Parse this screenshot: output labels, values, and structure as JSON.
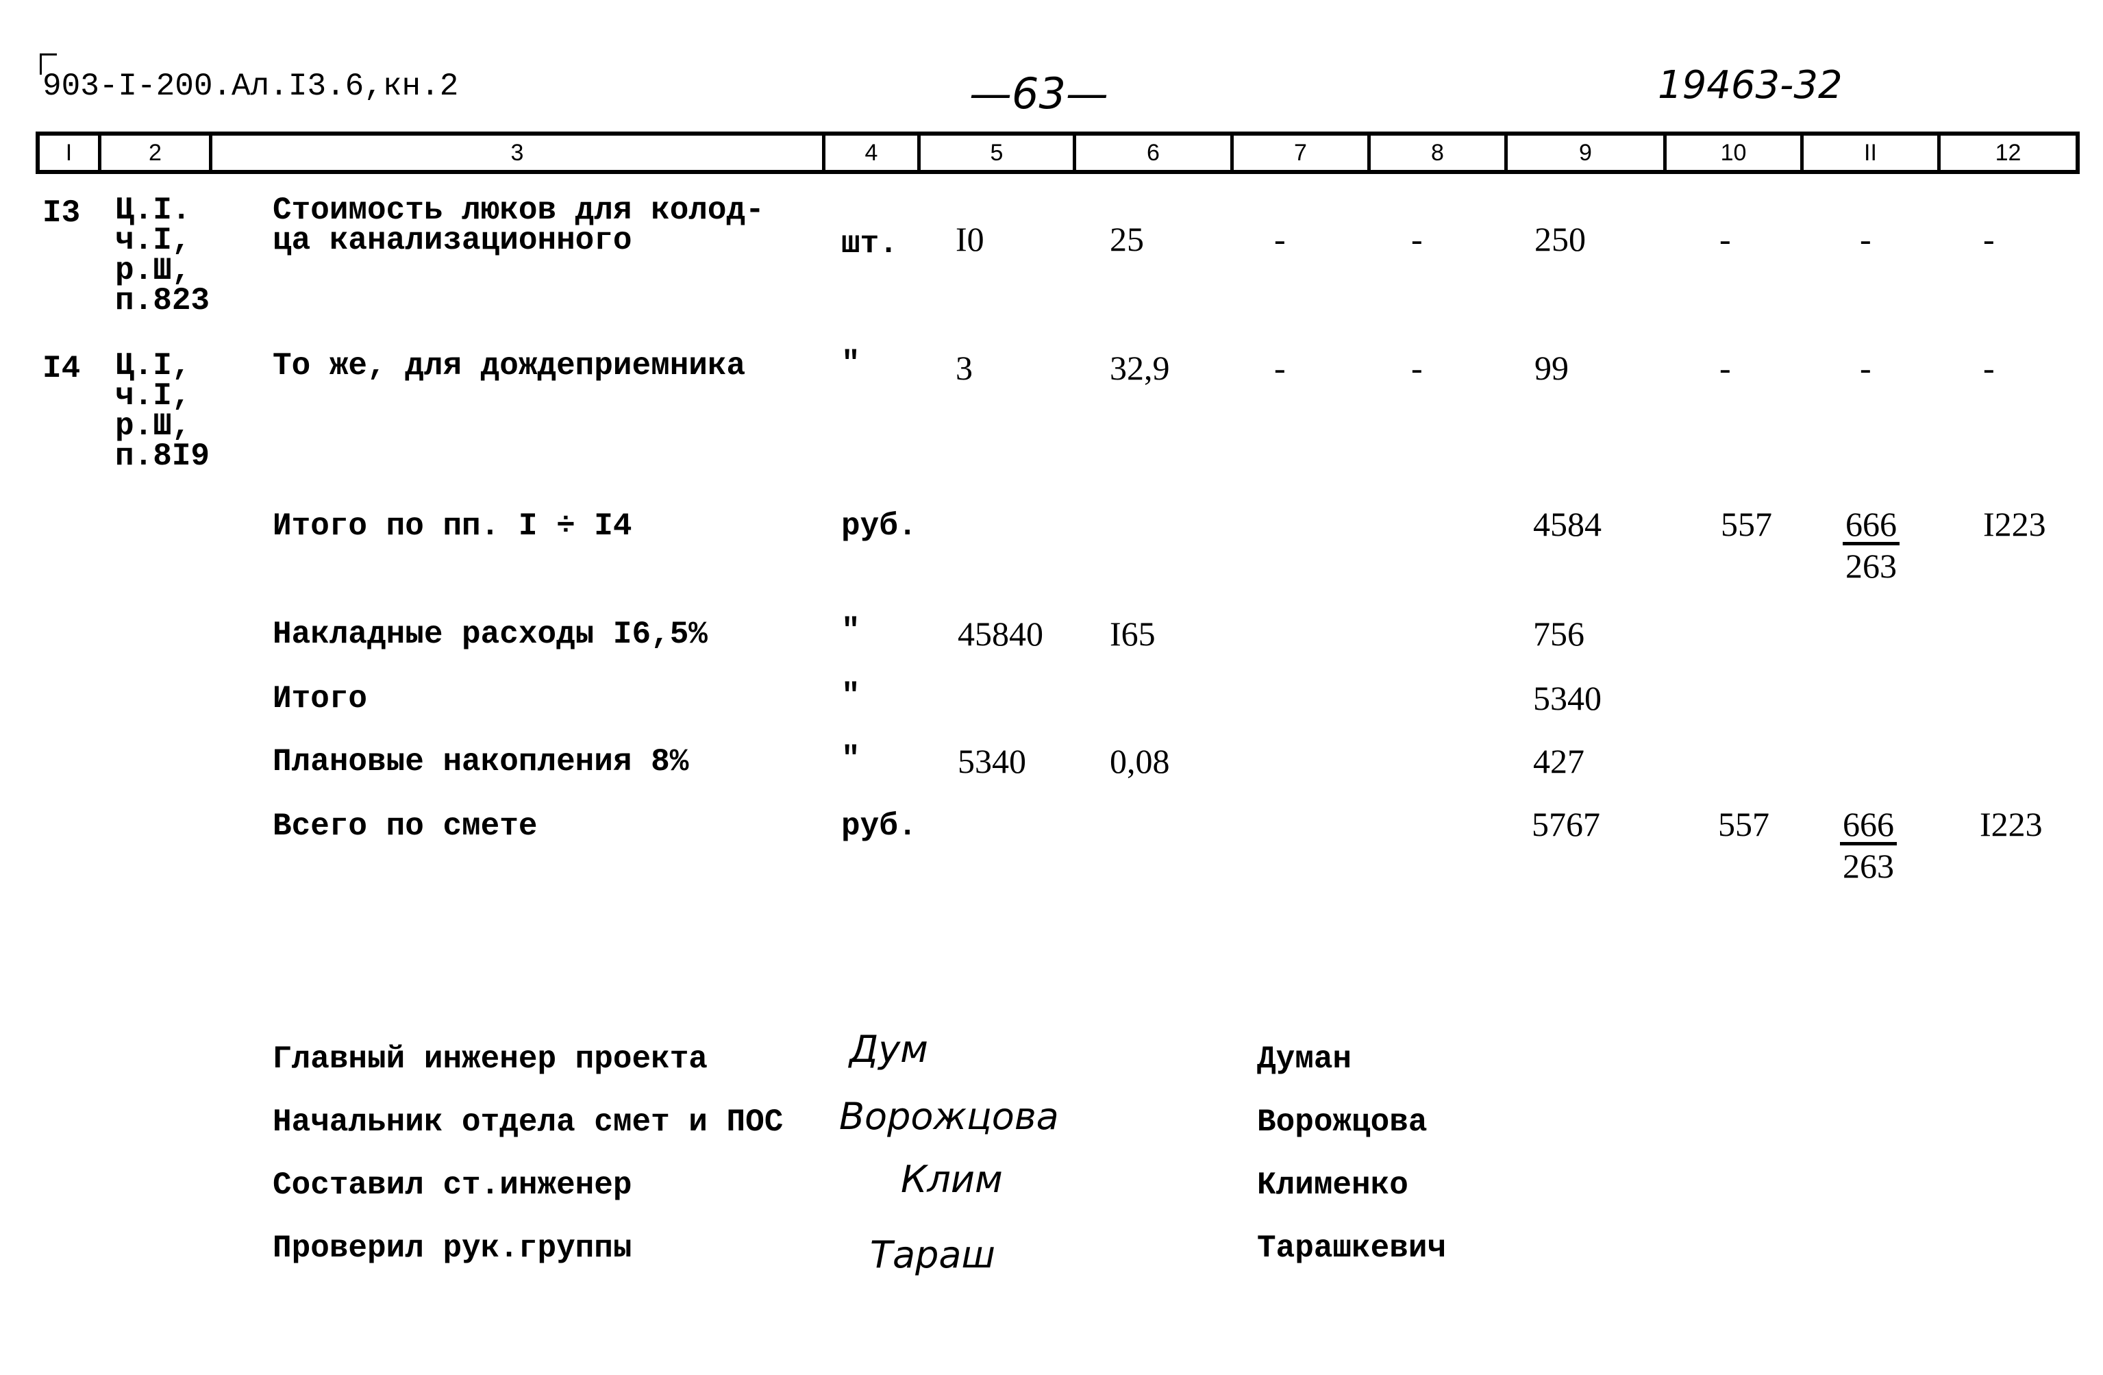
{
  "header": {
    "doc_code": "903-I-200.Ал.I3.6,кн.2",
    "page_number": "—63—",
    "sheet_number": "19463-32"
  },
  "columns": [
    "I",
    "2",
    "3",
    "4",
    "5",
    "6",
    "7",
    "8",
    "9",
    "10",
    "II",
    "12"
  ],
  "rows": [
    {
      "num": "I3",
      "ref": [
        "Ц.I.",
        "ч.I,",
        "р.Ш,",
        "п.823"
      ],
      "desc": [
        "Стоимость люков для колод-",
        "ца канализационного"
      ],
      "unit": "шт.",
      "c5": "I0",
      "c6": "25",
      "c7": "-",
      "c8": "-",
      "c9": "250",
      "c10": "-",
      "c11": "-",
      "c12": "-"
    },
    {
      "num": "I4",
      "ref": [
        "Ц.I,",
        "ч.I,",
        "р.Ш,",
        "п.8I9"
      ],
      "desc": [
        "То же, для дождеприемника"
      ],
      "unit": "\"",
      "c5": "3",
      "c6": "32,9",
      "c7": "-",
      "c8": "-",
      "c9": "99",
      "c10": "-",
      "c11": "-",
      "c12": "-"
    }
  ],
  "summary": [
    {
      "label": "Итого по пп. I ÷ I4",
      "unit": "руб.",
      "c5": "",
      "c6": "",
      "c9": "4584",
      "c10": "557",
      "c11_top": "666",
      "c11_bottom": "263",
      "c12": "I223"
    },
    {
      "label": "Накладные расходы I6,5%",
      "unit": "\"",
      "c5": "45840",
      "c6": "I65",
      "c9": "756"
    },
    {
      "label": "Итого",
      "unit": "\"",
      "c9": "5340"
    },
    {
      "label": "Плановые накопления 8%",
      "unit": "\"",
      "c5": "5340",
      "c6": "0,08",
      "c9": "427"
    },
    {
      "label": "Всего по смете",
      "unit": "руб.",
      "c9": "5767",
      "c10": "557",
      "c11_top": "666",
      "c11_bottom": "263",
      "c12": "I223"
    }
  ],
  "signatures": [
    {
      "role": "Главный инженер проекта",
      "signature": "Дум",
      "name": "Думан"
    },
    {
      "role": "Начальник отдела смет и ПОС",
      "signature": "Ворожцова",
      "name": "Ворожцова"
    },
    {
      "role": "Составил ст.инженер",
      "signature": "Клим",
      "name": "Клименко"
    },
    {
      "role": "Проверил рук.группы",
      "signature": "Тараш",
      "name": "Тарашкевич"
    }
  ]
}
